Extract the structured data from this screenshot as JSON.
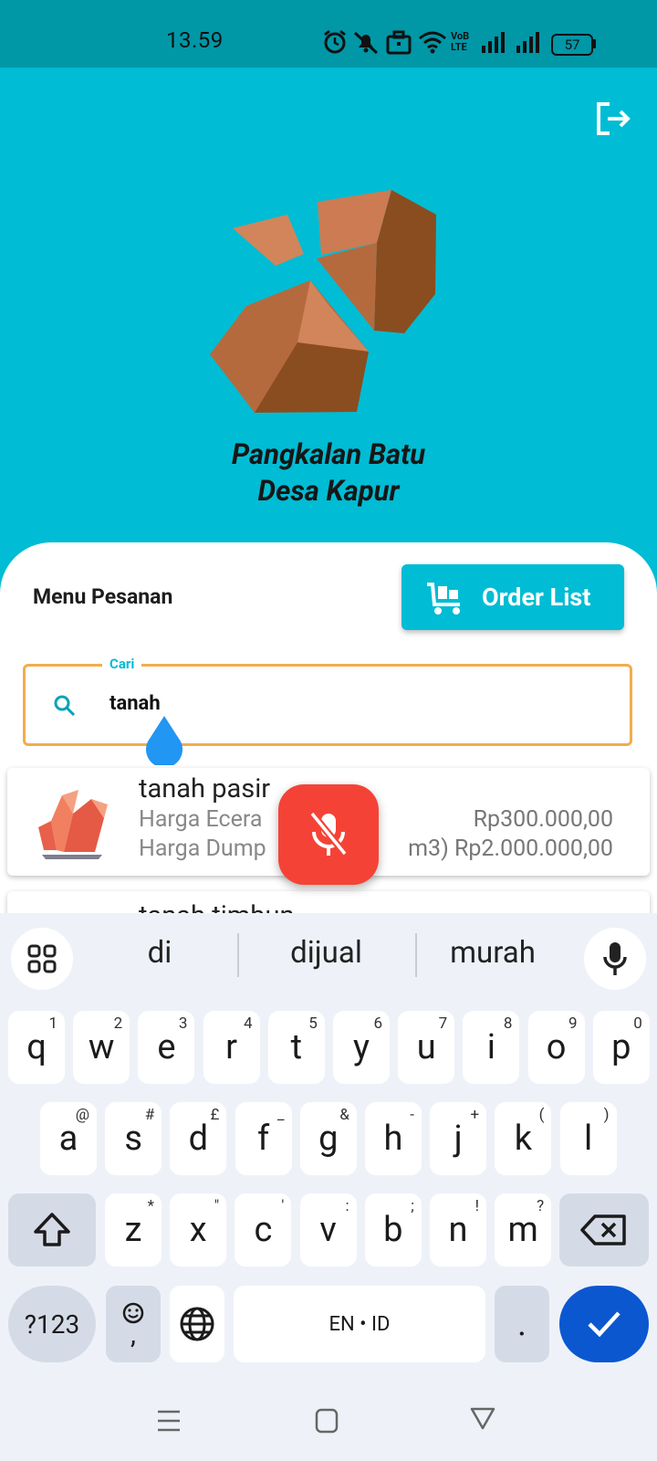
{
  "status": {
    "time": "13.59",
    "battery": "57",
    "net_label_top": "VoB",
    "net_label_bottom": "LTE"
  },
  "app": {
    "brand_line1": "Pangkalan Batu",
    "brand_line2": "Desa Kapur",
    "menu_title": "Menu Pesanan",
    "order_button": "Order List",
    "search": {
      "label": "Cari",
      "value": "tanah"
    },
    "products": [
      {
        "name": "tanah pasir",
        "line1_label": "Harga Ecera",
        "line1_value": "Rp300.000,00",
        "line2_label": "Harga Dump",
        "line2_value": "m3) Rp2.000.000,00"
      },
      {
        "name": "tanah timbun"
      }
    ]
  },
  "keyboard": {
    "suggestions": [
      "di",
      "dijual",
      "murah"
    ],
    "row1": [
      {
        "k": "q",
        "h": "1"
      },
      {
        "k": "w",
        "h": "2"
      },
      {
        "k": "e",
        "h": "3"
      },
      {
        "k": "r",
        "h": "4"
      },
      {
        "k": "t",
        "h": "5"
      },
      {
        "k": "y",
        "h": "6"
      },
      {
        "k": "u",
        "h": "7"
      },
      {
        "k": "i",
        "h": "8"
      },
      {
        "k": "o",
        "h": "9"
      },
      {
        "k": "p",
        "h": "0"
      }
    ],
    "row2": [
      {
        "k": "a",
        "h": "@"
      },
      {
        "k": "s",
        "h": "#"
      },
      {
        "k": "d",
        "h": "£"
      },
      {
        "k": "f",
        "h": "_"
      },
      {
        "k": "g",
        "h": "&"
      },
      {
        "k": "h",
        "h": "-"
      },
      {
        "k": "j",
        "h": "+"
      },
      {
        "k": "k",
        "h": "("
      },
      {
        "k": "l",
        "h": ")"
      }
    ],
    "row3": [
      {
        "k": "z",
        "h": "*"
      },
      {
        "k": "x",
        "h": "\""
      },
      {
        "k": "c",
        "h": "'"
      },
      {
        "k": "v",
        "h": ":"
      },
      {
        "k": "b",
        "h": ";"
      },
      {
        "k": "n",
        "h": "!"
      },
      {
        "k": "m",
        "h": "?"
      }
    ],
    "symbols_key": "?123",
    "emoji_comma": ",",
    "space_label": "EN • ID",
    "period": "."
  },
  "colors": {
    "primary": "#00bcd4",
    "status_bar": "#0097a7",
    "search_border": "#f0ad4e",
    "mic_fab": "#f44336",
    "enter_key": "#0b57d0"
  }
}
